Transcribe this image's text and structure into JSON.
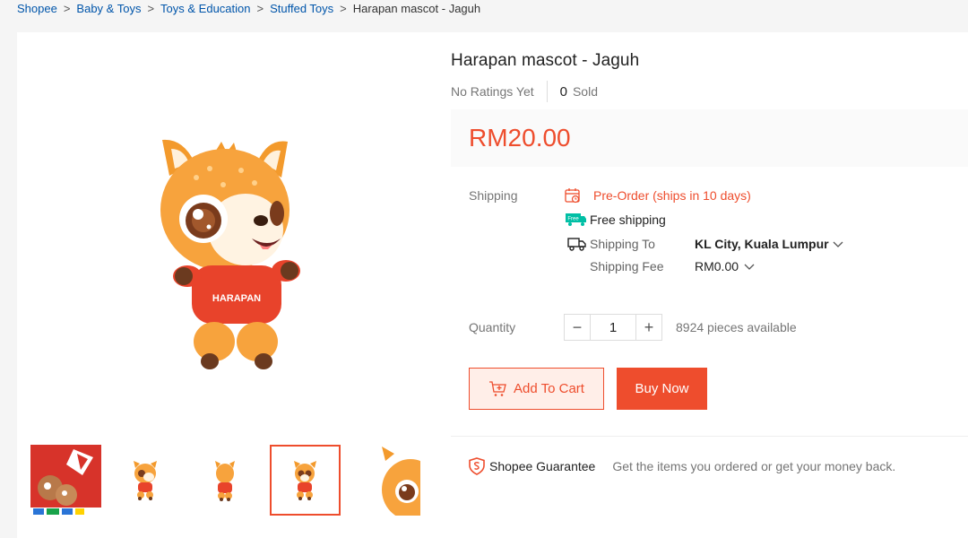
{
  "breadcrumb": {
    "items": [
      "Shopee",
      "Baby & Toys",
      "Toys & Education",
      "Stuffed Toys"
    ],
    "current": "Harapan mascot - Jaguh",
    "separator": ">"
  },
  "product": {
    "title": "Harapan mascot - Jaguh",
    "ratings": "No Ratings Yet",
    "sold_count": "0",
    "sold_label": "Sold",
    "price": "RM20.00",
    "shirt_text": "HARAPAN"
  },
  "shipping": {
    "label": "Shipping",
    "preorder": "Pre-Order (ships in 10 days)",
    "free_badge": "Free",
    "free_shipping": "Free shipping",
    "to_label": "Shipping To",
    "to_value": "KL City, Kuala Lumpur",
    "fee_label": "Shipping Fee",
    "fee_value": "RM0.00"
  },
  "quantity": {
    "label": "Quantity",
    "minus": "−",
    "value": "1",
    "plus": "+",
    "available": "8924 pieces available"
  },
  "actions": {
    "add_to_cart": "Add To Cart",
    "buy_now": "Buy Now"
  },
  "guarantee": {
    "title": "Shopee Guarantee",
    "description": "Get the items you ordered or get your money back."
  },
  "colors": {
    "accent": "#ee4d2d",
    "link": "#0055aa",
    "free_badge": "#00bfa5"
  },
  "icons": [
    "preorder-calendar-icon",
    "free-shipping-truck-icon",
    "truck-icon",
    "chevron-down-icon",
    "cart-add-icon",
    "shield-icon"
  ]
}
